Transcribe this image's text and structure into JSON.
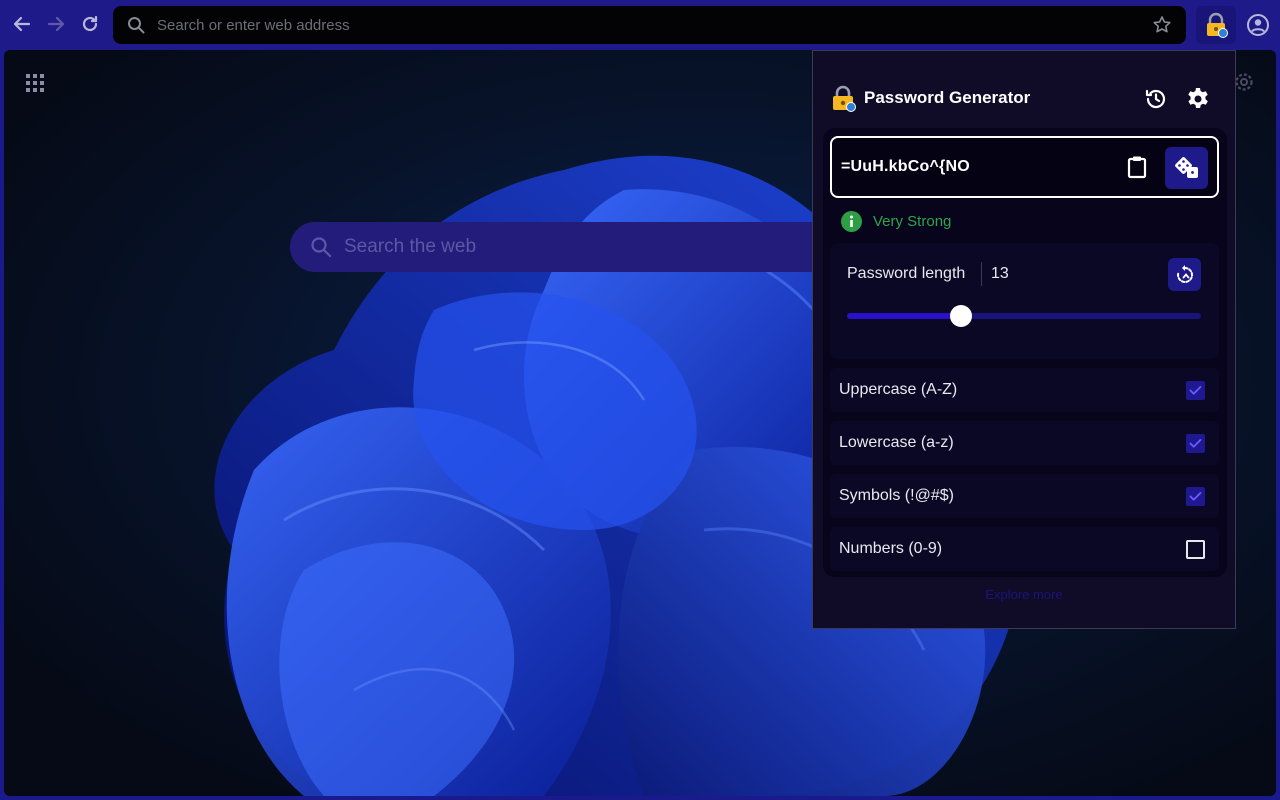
{
  "browser": {
    "address_placeholder": "Search or enter web address"
  },
  "newtab": {
    "search_placeholder": "Search the web"
  },
  "popup": {
    "title": "Password Generator",
    "password": "=UuH.kbCo^{NO",
    "strength": "Very Strong",
    "length_label": "Password length",
    "length_value": "13",
    "length_min": 4,
    "length_max": 32,
    "options": [
      {
        "label": "Uppercase (A-Z)",
        "checked": true
      },
      {
        "label": "Lowercase (a-z)",
        "checked": true
      },
      {
        "label": "Symbols (!@#$)",
        "checked": true
      },
      {
        "label": "Numbers (0-9)",
        "checked": false
      }
    ],
    "footer_link": "Explore more"
  },
  "colors": {
    "accent": "#1e1a8a",
    "strength_green": "#2fa44d",
    "popup_bg": "#100c28"
  },
  "icons": {
    "back": "arrow-left-icon",
    "forward": "arrow-right-icon",
    "reload": "reload-icon",
    "search": "search-icon",
    "bookmark": "star-icon",
    "extension": "lock-icon",
    "profile": "profile-icon",
    "apps": "grid-icon",
    "history": "history-icon",
    "settings": "gear-icon",
    "copy": "clipboard-icon",
    "generate": "dice-icon",
    "strength": "info-icon",
    "reset": "reset-icon"
  }
}
